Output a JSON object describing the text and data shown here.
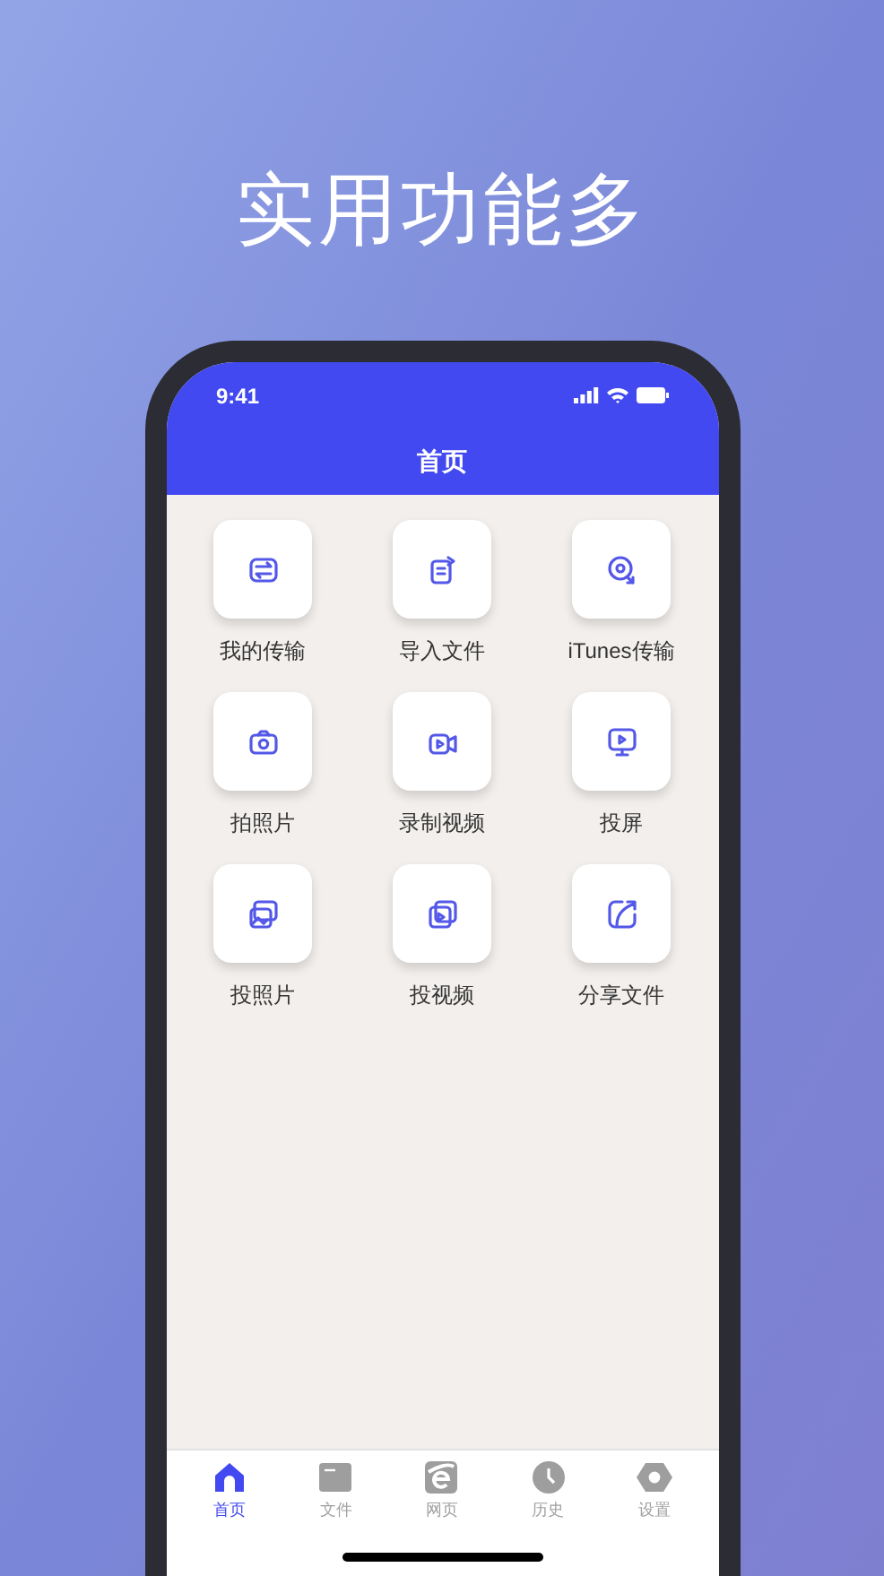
{
  "headline": "实用功能多",
  "status_bar": {
    "time": "9:41"
  },
  "header": {
    "title": "首页"
  },
  "features": [
    {
      "label": "我的传输"
    },
    {
      "label": "导入文件"
    },
    {
      "label": "iTunes传输"
    },
    {
      "label": "拍照片"
    },
    {
      "label": "录制视频"
    },
    {
      "label": "投屏"
    },
    {
      "label": "投照片"
    },
    {
      "label": "投视频"
    },
    {
      "label": "分享文件"
    }
  ],
  "tab_bar": [
    {
      "label": "首页",
      "selected": true
    },
    {
      "label": "文件",
      "selected": false
    },
    {
      "label": "网页",
      "selected": false
    },
    {
      "label": "历史",
      "selected": false
    },
    {
      "label": "设置",
      "selected": false
    }
  ]
}
